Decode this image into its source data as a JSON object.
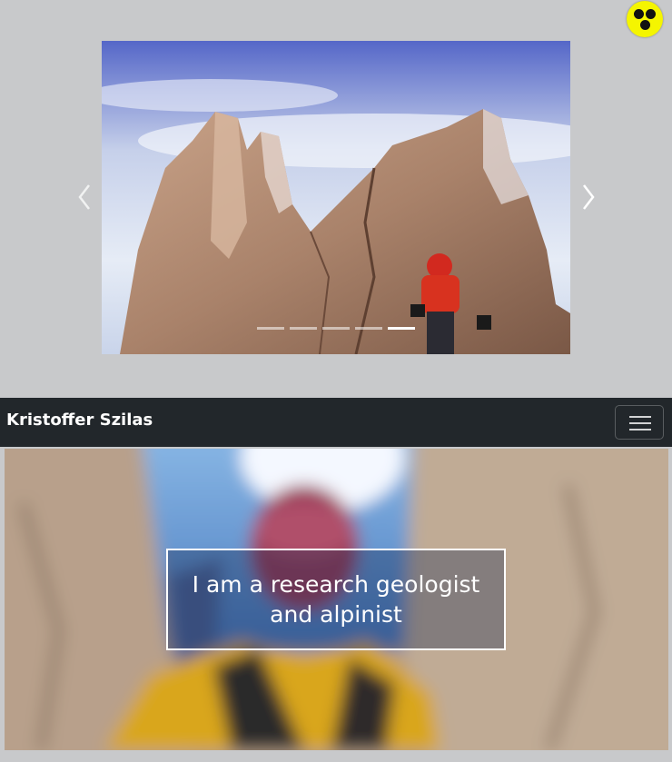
{
  "accessibility": {
    "icon": "low-vision-icon",
    "color": "#f5f500"
  },
  "carousel": {
    "slide_count": 5,
    "active_index": 4,
    "prev_icon": "chevron-left-icon",
    "next_icon": "chevron-right-icon"
  },
  "navbar": {
    "brand": "Kristoffer Szilas",
    "toggler_icon": "hamburger-menu-icon",
    "background": "#22272b"
  },
  "hero": {
    "heading": "I am a research geologist and alpinist"
  }
}
